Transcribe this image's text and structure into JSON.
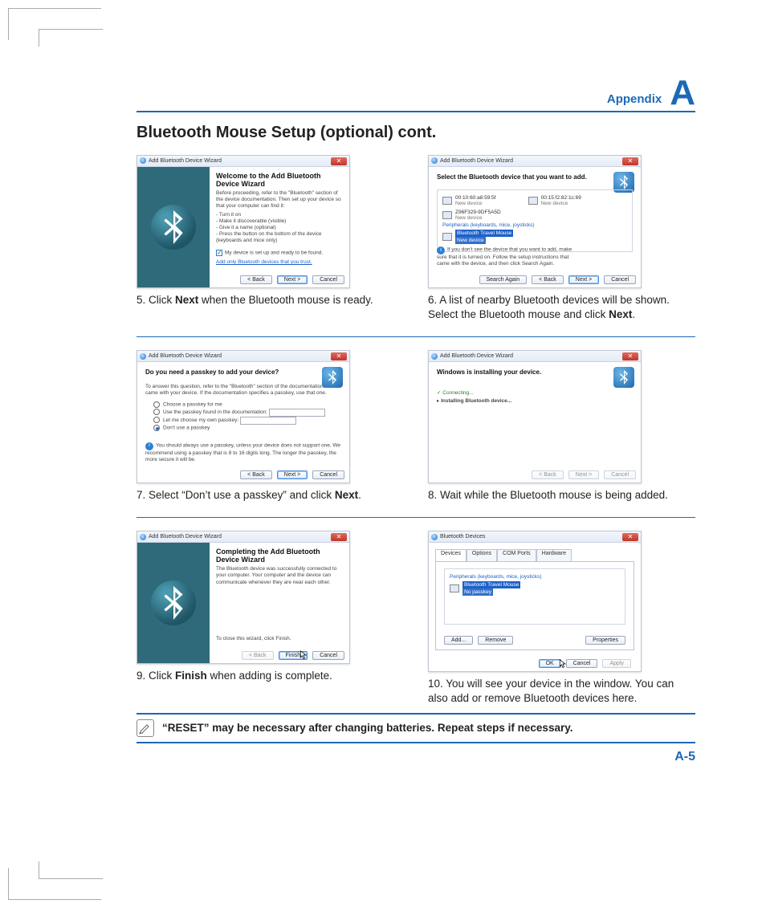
{
  "header": {
    "appendix_label": "Appendix",
    "appendix_letter": "A"
  },
  "title": "Bluetooth Mouse Setup (optional) cont.",
  "wiz_title": "Add Bluetooth Device Wizard",
  "btn": {
    "back": "< Back",
    "next": "Next >",
    "cancel": "Cancel",
    "finish": "Finish",
    "search_again": "Search Again",
    "ok": "OK",
    "apply": "Apply",
    "add": "Add...",
    "remove": "Remove",
    "properties": "Properties"
  },
  "step5": {
    "h": "Welcome to the Add Bluetooth Device Wizard",
    "p1": "Before proceeding, refer to the \"Bluetooth\" section of the device documentation. Then set up your device so that your computer can find it:",
    "b1": "- Turn it on",
    "b2": "- Make it discoverable (visible)",
    "b3": "- Give it a name (optional)",
    "b4": "- Press the button on the bottom of the device (keyboards and mice only)",
    "chk": "My device is set up and ready to be found.",
    "link": "Add only Bluetooth devices that you trust.",
    "caption_a": "5.  Click ",
    "caption_b": "Next",
    "caption_c": " when the Bluetooth mouse is ready."
  },
  "step6": {
    "h": "Select the Bluetooth device that you want to add.",
    "d1_mac": "00:10:60:a8:59:5f",
    "d1_sub": "New device",
    "d2_mac": "00:15:f2:82:1c:69",
    "d2_sub": "New device",
    "d3_mac": "Z96F329-9DF5A5D",
    "d3_sub": "New device",
    "cat": "Peripherals (keyboards, mice, joysticks)",
    "sel": "Bluetooth Travel Mouse",
    "sel_sub": "New device",
    "note": "If you don't see the device that you want to add, make sure that it is turned on. Follow the setup instructions that came with the device, and then click Search Again.",
    "caption_a": "6.  A list of nearby Bluetooth devices will be shown. Select the Bluetooth mouse and click ",
    "caption_b": "Next",
    "caption_c": "."
  },
  "step7": {
    "h": "Do you need a passkey to add your device?",
    "p": "To answer this question, refer to the \"Bluetooth\" section of the documentation that came with your device. If the documentation specifies a passkey, use that one.",
    "r1": "Choose a passkey for me",
    "r2": "Use the passkey found in the documentation:",
    "r3": "Let me choose my own passkey:",
    "r4": "Don't use a passkey",
    "warn": "You should always use a passkey, unless your device does not support one. We recommend using a passkey that is 8 to 16 digits long. The longer the passkey, the more secure it will be.",
    "caption_a": "7.  Select “Don’t use a passkey” and click ",
    "caption_b": "Next",
    "caption_c": "."
  },
  "step8": {
    "h": "Windows is installing your device.",
    "l1": "Connecting...",
    "l2": "Installing Bluetooth device...",
    "caption": "8.  Wait while the Bluetooth mouse is being added."
  },
  "step9": {
    "h": "Completing the Add Bluetooth Device Wizard",
    "p1": "The Bluetooth device was successfully connected to your computer. Your computer and the device can communicate whenever they are near each other.",
    "p2": "To close this wizard, click Finish.",
    "caption_a": "9.  Click ",
    "caption_b": "Finish",
    "caption_c": " when adding is complete."
  },
  "step10": {
    "wintitle": "Bluetooth Devices",
    "tabs": [
      "Devices",
      "Options",
      "COM Ports",
      "Hardware"
    ],
    "cat": "Peripherals (keyboards, mice, joysticks)",
    "dev": "Bluetooth Travel Mouse",
    "dev_sub": "No passkey",
    "caption": "10. You will see your device in the window. You can also add or remove Bluetooth devices here."
  },
  "reset_note": "“RESET” may be necessary after changing batteries. Repeat steps if necessary.",
  "page_number": "A-5"
}
